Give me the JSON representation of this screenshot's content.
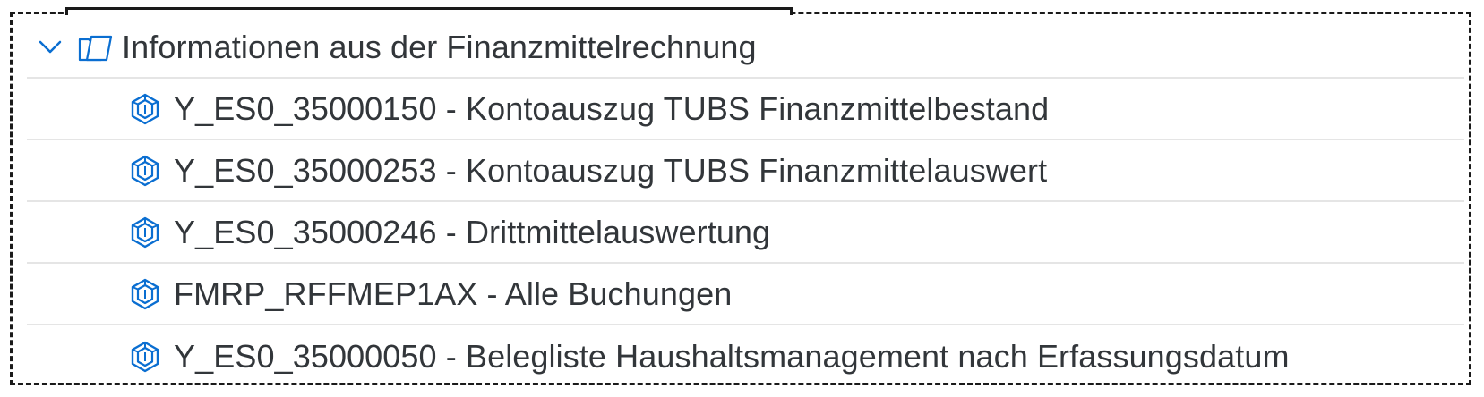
{
  "tree": {
    "folder": {
      "label": "Informationen aus der Finanzmittelrechnung",
      "expanded": true,
      "chevron_icon": "chevron-down-icon",
      "folder_icon": "open-folder-icon"
    },
    "items": [
      {
        "label": "Y_ES0_35000150 - Kontoauszug TUBS Finanzmittelbestand",
        "icon": "report-cube-icon"
      },
      {
        "label": "Y_ES0_35000253 - Kontoauszug TUBS Finanzmittelauswert",
        "icon": "report-cube-icon"
      },
      {
        "label": "Y_ES0_35000246 - Drittmittelauswertung",
        "icon": "report-cube-icon"
      },
      {
        "label": "FMRP_RFFMEP1AX - Alle Buchungen",
        "icon": "report-cube-icon"
      },
      {
        "label": "Y_ES0_35000050 - Belegliste Haushaltsmanagement nach Erfassungsdatum",
        "icon": "report-cube-icon"
      }
    ]
  },
  "colors": {
    "text": "#32363a",
    "icon": "#0a6ed1",
    "separator": "#e5e5e5",
    "frame": "#1a1a1a"
  }
}
